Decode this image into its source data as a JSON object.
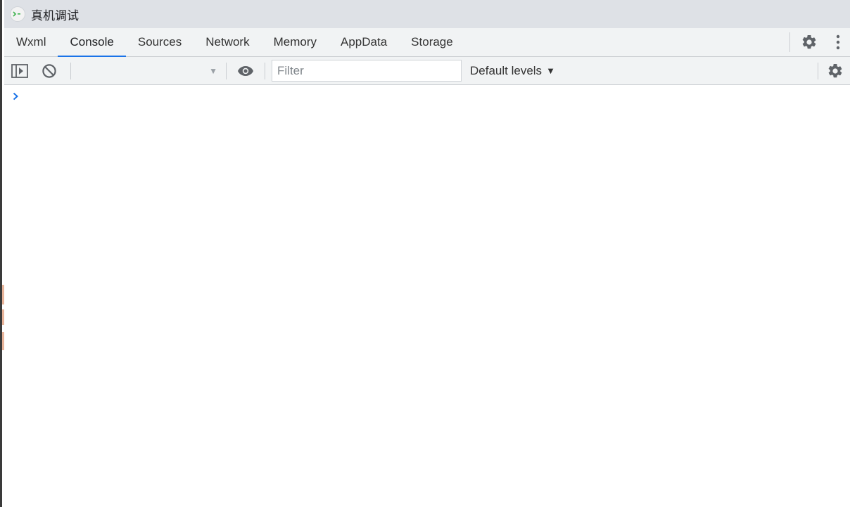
{
  "window": {
    "title": "真机调试",
    "icon": "wechat-devtools-app-icon"
  },
  "tabs": [
    {
      "label": "Wxml",
      "active": false
    },
    {
      "label": "Console",
      "active": true
    },
    {
      "label": "Sources",
      "active": false
    },
    {
      "label": "Network",
      "active": false
    },
    {
      "label": "Memory",
      "active": false
    },
    {
      "label": "AppData",
      "active": false
    },
    {
      "label": "Storage",
      "active": false
    }
  ],
  "tab_actions": {
    "settings_icon": "gear-icon",
    "more_icon": "kebab-menu-icon"
  },
  "console_toolbar": {
    "sidebar_toggle_icon": "sidebar-toggle-icon",
    "clear_icon": "clear-console-icon",
    "context_selected": "",
    "eye_icon": "eye-icon",
    "filter": {
      "value": "",
      "placeholder": "Filter"
    },
    "levels_label": "Default levels",
    "settings_icon": "gear-icon"
  },
  "console": {
    "prompt_icon": "chevron-right-icon"
  },
  "colors": {
    "accent": "#1a73e8",
    "titlebar": "#dee1e6",
    "toolbar": "#f1f3f4",
    "icon": "#5f6368"
  }
}
